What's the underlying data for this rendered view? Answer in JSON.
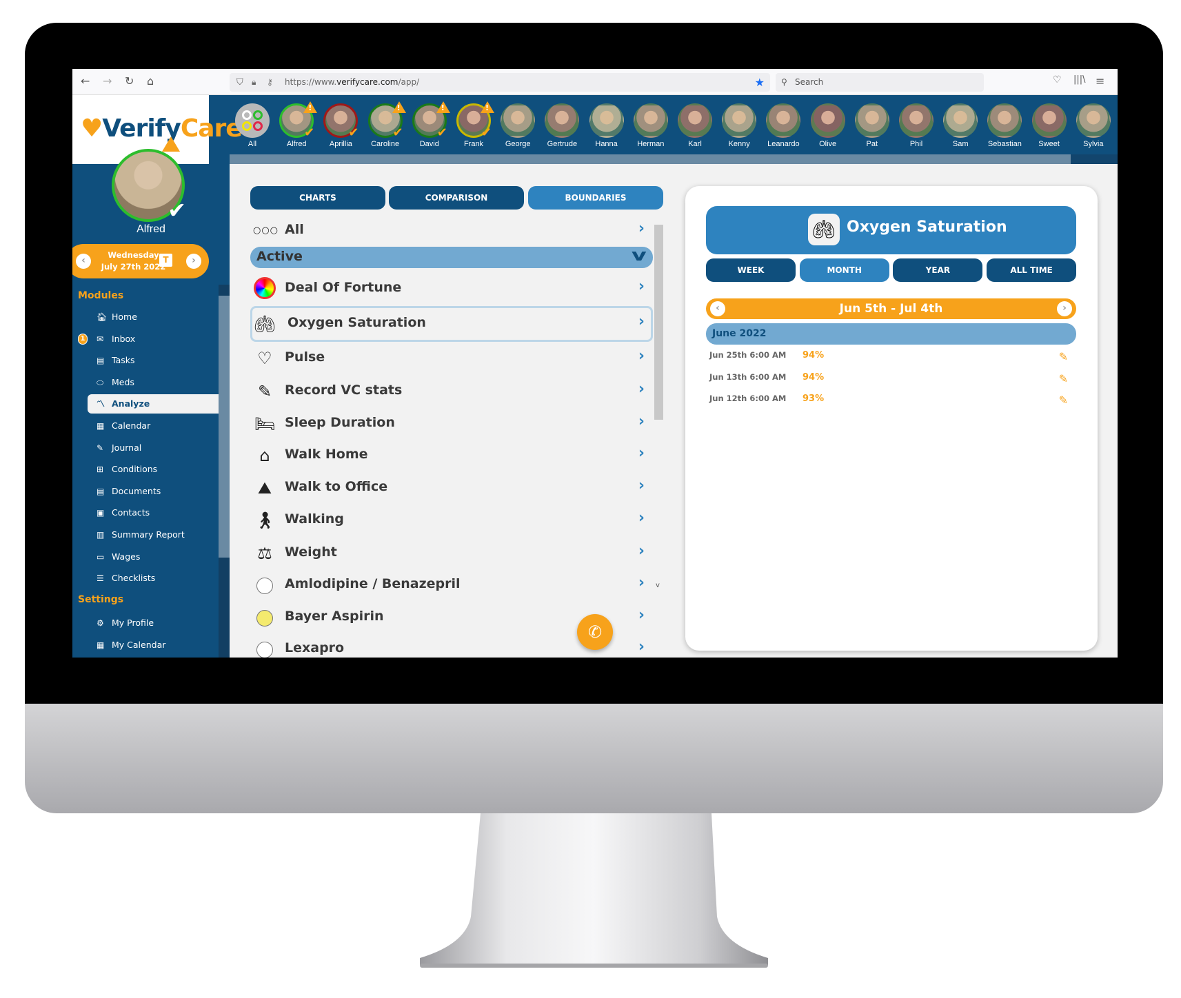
{
  "browser": {
    "url_prefix": "https://www.",
    "url_domain": "verifycare.com",
    "url_path": "/app/",
    "search_placeholder": "Search"
  },
  "colors": {
    "brand_blue": "#0f4f7d",
    "accent_blue": "#2e83bf",
    "light_blue": "#72a9d1",
    "orange": "#f7a21b"
  },
  "avatars": [
    {
      "name": "All",
      "ring": "none",
      "warning": false,
      "check": false
    },
    {
      "name": "Alfred",
      "ring": "#2dbd2d",
      "warning": true,
      "check": true
    },
    {
      "name": "Aprillia",
      "ring": "#a01818",
      "warning": false,
      "check": true
    },
    {
      "name": "Caroline",
      "ring": "#1a7a1a",
      "warning": true,
      "check": true
    },
    {
      "name": "David",
      "ring": "#1a7a1a",
      "warning": true,
      "check": true
    },
    {
      "name": "Frank",
      "ring": "#c9b800",
      "warning": true,
      "check": true
    },
    {
      "name": "George",
      "ring": "none",
      "warning": false,
      "check": false
    },
    {
      "name": "Gertrude",
      "ring": "none",
      "warning": false,
      "check": false
    },
    {
      "name": "Hanna",
      "ring": "none",
      "warning": false,
      "check": false
    },
    {
      "name": "Herman",
      "ring": "none",
      "warning": false,
      "check": false
    },
    {
      "name": "Karl",
      "ring": "none",
      "warning": false,
      "check": false
    },
    {
      "name": "Kenny",
      "ring": "none",
      "warning": false,
      "check": false
    },
    {
      "name": "Leanardo",
      "ring": "none",
      "warning": false,
      "check": false
    },
    {
      "name": "Olive",
      "ring": "none",
      "warning": false,
      "check": false
    },
    {
      "name": "Pat",
      "ring": "none",
      "warning": false,
      "check": false
    },
    {
      "name": "Phil",
      "ring": "none",
      "warning": false,
      "check": false
    },
    {
      "name": "Sam",
      "ring": "none",
      "warning": false,
      "check": false
    },
    {
      "name": "Sebastian",
      "ring": "none",
      "warning": false,
      "check": false
    },
    {
      "name": "Sweet",
      "ring": "none",
      "warning": false,
      "check": false
    },
    {
      "name": "Sylvia",
      "ring": "none",
      "warning": false,
      "check": false
    }
  ],
  "sidebar": {
    "logo_text": "VerifyCare",
    "selected_client": "Alfred",
    "date_day": "Wednesday",
    "date_full": "July 27th 2022",
    "today_label": "T",
    "modules_heading": "Modules",
    "inbox_badge": "1",
    "modules": [
      {
        "label": "Home",
        "icon": "home-icon"
      },
      {
        "label": "Inbox",
        "icon": "mail-icon"
      },
      {
        "label": "Tasks",
        "icon": "clipboard-icon"
      },
      {
        "label": "Meds",
        "icon": "pill-icon"
      },
      {
        "label": "Analyze",
        "icon": "chart-line-icon",
        "active": true
      },
      {
        "label": "Calendar",
        "icon": "calendar-icon"
      },
      {
        "label": "Journal",
        "icon": "edit-icon"
      },
      {
        "label": "Conditions",
        "icon": "conditions-icon"
      },
      {
        "label": "Documents",
        "icon": "documents-icon"
      },
      {
        "label": "Contacts",
        "icon": "contacts-icon"
      },
      {
        "label": "Summary Report",
        "icon": "report-icon"
      },
      {
        "label": "Wages",
        "icon": "money-icon"
      },
      {
        "label": "Checklists",
        "icon": "list-icon"
      }
    ],
    "settings_heading": "Settings",
    "settings": [
      {
        "label": "My Profile",
        "icon": "gear-icon"
      },
      {
        "label": "My Calendar",
        "icon": "calendar-icon"
      }
    ]
  },
  "middle": {
    "tabs": [
      {
        "label": "CHARTS",
        "active": false
      },
      {
        "label": "COMPARISON",
        "active": false
      },
      {
        "label": "BOUNDARIES",
        "active": true
      }
    ],
    "all_label": "All",
    "active_label": "Active",
    "items": [
      {
        "label": "Deal Of Fortune",
        "icon": "wheel-icon"
      },
      {
        "label": "Oxygen Saturation",
        "icon": "lungs-icon",
        "selected": true
      },
      {
        "label": "Pulse",
        "icon": "heart-pulse-icon"
      },
      {
        "label": "Record VC stats",
        "icon": "record-icon"
      },
      {
        "label": "Sleep Duration",
        "icon": "sleep-icon"
      },
      {
        "label": "Walk Home",
        "icon": "house-icon"
      },
      {
        "label": "Walk to Office",
        "icon": "hiker-icon"
      },
      {
        "label": "Walking",
        "icon": "walker-icon"
      },
      {
        "label": "Weight",
        "icon": "scale-icon"
      },
      {
        "label": "Amlodipine / Benazepril",
        "icon": "white-pill-icon"
      },
      {
        "label": "Bayer Aspirin",
        "icon": "yellow-pill-icon"
      },
      {
        "label": "Lexapro",
        "icon": "white-pill-icon"
      }
    ]
  },
  "detail": {
    "title": "Oxygen Saturation",
    "periods": [
      {
        "label": "WEEK",
        "active": false
      },
      {
        "label": "MONTH",
        "active": true
      },
      {
        "label": "YEAR",
        "active": false
      },
      {
        "label": "ALL TIME",
        "active": false
      }
    ],
    "range": "Jun 5th - Jul 4th",
    "month": "June 2022",
    "records": [
      {
        "date": "Jun 25th 6:00 AM",
        "value": "94%"
      },
      {
        "date": "Jun 13th 6:00 AM",
        "value": "94%"
      },
      {
        "date": "Jun 12th 6:00 AM",
        "value": "93%"
      }
    ]
  }
}
